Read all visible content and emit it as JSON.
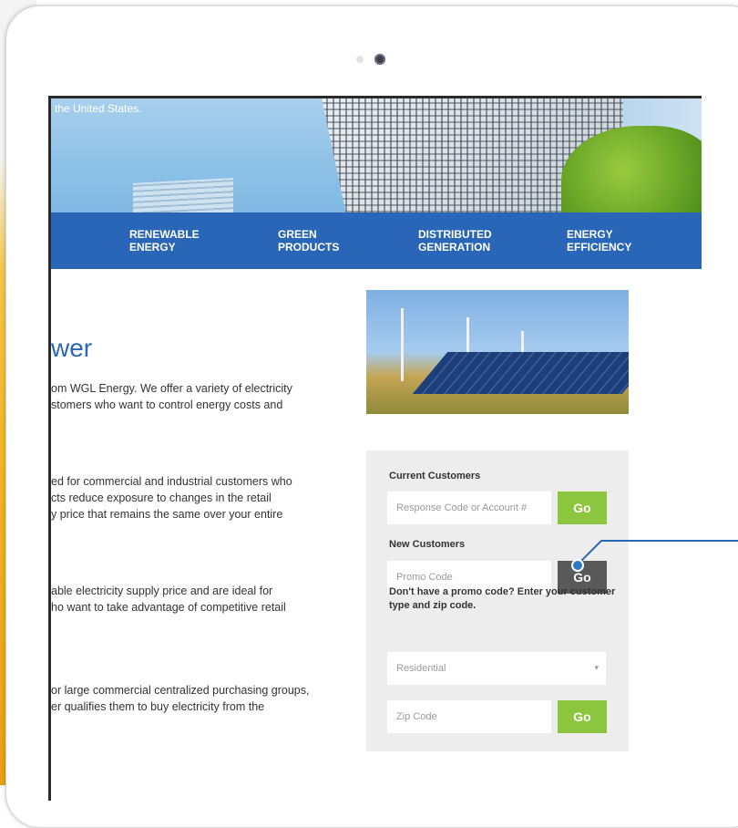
{
  "hero": {
    "text": "the United States."
  },
  "nav": {
    "items": [
      {
        "label": "RENEWABLE\nENERGY"
      },
      {
        "label": "GREEN\nPRODUCTS"
      },
      {
        "label": "DISTRIBUTED\nGENERATION"
      },
      {
        "label": "ENERGY\nEFFICIENCY"
      }
    ]
  },
  "content": {
    "heading": "wer",
    "paragraphs": [
      "om WGL Energy. We offer a variety of electricity\nstomers who want to control energy costs and",
      "ed for commercial and industrial customers who\ncts reduce exposure to changes in the retail\ny price that remains the same over your entire",
      "able electricity supply price and are ideal for\nho want to take advantage of competitive retail",
      "or large commercial centralized purchasing groups,\ner qualifies them to buy electricity from the"
    ]
  },
  "form": {
    "current_customers_label": "Current Customers",
    "response_placeholder": "Response Code or Account #",
    "go_label": "Go",
    "new_customers_label": "New Customers",
    "promo_placeholder": "Promo Code",
    "hint": "Don't have a promo code? Enter your customer type and zip code.",
    "customer_type_selected": "Residential",
    "zip_placeholder": "Zip Code"
  },
  "colors": {
    "brand_blue": "#2a66b7",
    "go_green": "#8cc63f",
    "go_dark": "#595959"
  }
}
